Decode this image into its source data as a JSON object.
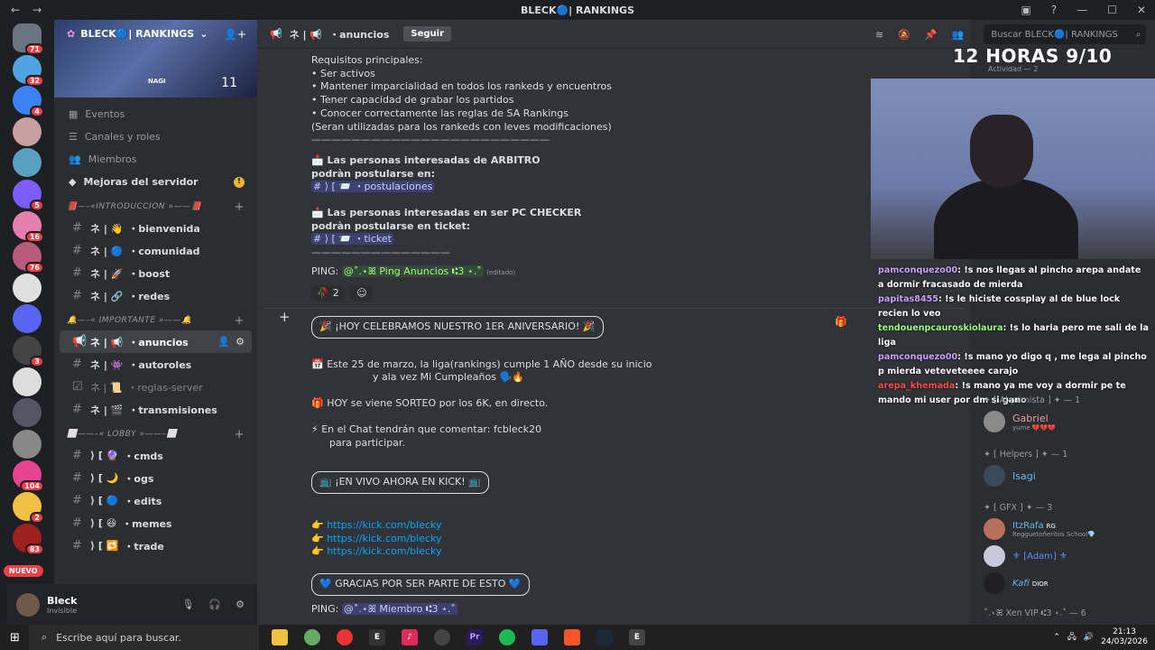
{
  "window": {
    "title": "BLECK🔵| RANKINGS"
  },
  "servers": [
    {
      "badge": "71"
    },
    {
      "badge": "32"
    },
    {
      "badge": "4"
    },
    {
      "badge": ""
    },
    {
      "badge": ""
    },
    {
      "badge": "5"
    },
    {
      "badge": "16"
    },
    {
      "badge": "76"
    },
    {
      "badge": ""
    },
    {
      "badge": ""
    },
    {
      "badge": "3"
    },
    {
      "badge": ""
    },
    {
      "badge": ""
    },
    {
      "badge": ""
    },
    {
      "badge": "104"
    },
    {
      "badge": "2"
    },
    {
      "badge": "83"
    }
  ],
  "nuevo": "NUEVO",
  "guild": {
    "name": "BLECK🔵| RANKINGS",
    "banner_char": "NAGI",
    "banner_ii": "11"
  },
  "menu": [
    {
      "label": "Eventos"
    },
    {
      "label": "Canales y roles"
    },
    {
      "label": "Miembros"
    },
    {
      "label": "Mejoras del servidor",
      "warn": "!"
    }
  ],
  "categories": {
    "introduccion": "📕—–«INTRODUCCION »——📕",
    "importante": "🔔—–« IMPORTANTE »——🔔",
    "lobby": "⬜——–« LOBBY »——–⬜"
  },
  "channels_intro": [
    {
      "prefix": "ネ | 👋",
      "label": "・bienvenida"
    },
    {
      "prefix": "ネ | 🔵",
      "label": "・comunidad"
    },
    {
      "prefix": "ネ | 🚀",
      "label": "・boost"
    },
    {
      "prefix": "ネ | 🔗",
      "label": "・redes"
    }
  ],
  "channels_imp": [
    {
      "prefix": "ネ | 📢",
      "label": "・anuncios"
    },
    {
      "prefix": "ネ | 👾",
      "label": "・autoroles"
    },
    {
      "prefix": "ネ | 📜",
      "label": "・reglas-server"
    },
    {
      "prefix": "ネ | 🎬",
      "label": "・transmisiones"
    }
  ],
  "channels_lobby": [
    {
      "prefix": "⟩ [ 🔮",
      "label": "・cmds"
    },
    {
      "prefix": "⟩ [ 🌙",
      "label": "・ogs"
    },
    {
      "prefix": "⟩ [ 🔵",
      "label": "・edits"
    },
    {
      "prefix": "⟩ [ 😆",
      "label": "・memes"
    },
    {
      "prefix": "⟩ [ 🔁",
      "label": "・trade"
    }
  ],
  "user": {
    "name": "Bleck",
    "status": "Invisible"
  },
  "header": {
    "channel_prefix": "ネ | 📢",
    "channel": "・anuncios",
    "follow": "Seguir",
    "search": "Buscar BLECK🔵| RANKINGS"
  },
  "msg1": {
    "lines": [
      "Requisitos principales:",
      "• Ser activos",
      "• Mantener imparcialidad en todos los rankeds y encuentros",
      "• Tener capacidad de grabar los partidos",
      "• Conocer correctamente las reglas de SA Rankings",
      "(Seran utilizadas para los rankeds con leves modificaciones)",
      "————————————————————————"
    ],
    "arbitro_1": "📩 Las personas interesadas de ARBITRO",
    "arbitro_2": "podràn postularse en:",
    "arbitro_ch": "# ⟩ [ 📨 ・postulaciones",
    "pc_1": "📩 Las personas interesadas en ser PC CHECKER",
    "pc_2": "podràn postularse en ticket:",
    "pc_ch": "# ⟩ [ 📨 ・ticket",
    "rule": "——————————————",
    "ping": "PING:",
    "ping_role": "@˚.⋆ꕤ Ping Anuncios ⑆3 ⋆.˚",
    "edited": "(editado)",
    "reaction_count": "2"
  },
  "msg2": {
    "title": "🎉 ¡HOY CELEBRAMOS NUESTRO 1ER ANIVERSARIO! 🎉",
    "l1": "📅 Este 25 de marzo, la liga(rankings) cumple 1 AÑO desde su inicio",
    "l2": "y ala vez Mi Cumpleaños 🗣️🔥",
    "l3": "🎁 HOY se viene SORTEO por los 6K, en directo.",
    "l4": "⚡ En el Chat tendrán que comentar: fcbleck20",
    "l5": "para participar.",
    "kick": "📺 ¡EN VIVO AHORA EN KICK! 📺",
    "links": [
      "https://kick.com/blecky",
      "https://kick.com/blecky",
      "https://kick.com/blecky"
    ],
    "thanks": "💙 GRACIAS POR SER PARTE DE ESTO 💙",
    "ping": "PING:",
    "ping_role": "@˚.⋆ꕤ Miembro ⑆3 ⋆.˚"
  },
  "overlay": {
    "title": "12 HORAS 9/10",
    "activity": "Actividad — 2"
  },
  "chat": [
    {
      "user": "pamconquezo00",
      "color": "#c9a2ff",
      "text": ": !s nos llegas al pincho arepa andate a dormir fracasado de mierda"
    },
    {
      "user": "papitas8455",
      "color": "#c9a2ff",
      "text": ": !s le hiciste cossplay al de blue lock recien lo veo"
    },
    {
      "user": "tendouenpcauroskiolaura",
      "color": "#9cff7a",
      "text": ": !s lo haria pero me sali de la liga"
    },
    {
      "user": "pamconquezo00",
      "color": "#c9a2ff",
      "text": ": !s mano yo digo q , me lega al pincho p mierda veteveteeee carajo"
    },
    {
      "user": "arepa_khemada",
      "color": "#ff4d4d",
      "text": ": !s mano ya me voy a dormir pe te mando mi user por dm si gano"
    }
  ],
  "members": {
    "alquimista": "✦ [ Alquimista ] ✦ — 1",
    "gabriel": "Gabriel",
    "gabriel_status": "yume 💔💔💔",
    "helpers": "✦ [ Helpers ] ✦ — 1",
    "isagi": "Isagi",
    "gfx": "✦ [ GFX ] ✦ — 3",
    "itzrafa": "ItzRafa",
    "itzrafa_tag": "RG",
    "itzrafa_status": "Regguetoñeritos School💎",
    "adam": "⚜ [Adam] ⚜",
    "kafi": "Kafi",
    "kafi_tag": "DIOR",
    "xenvip": "˚.⋆ꕤ Xen VIP ⑆3 ⋆.˚ — 6"
  },
  "taskbar": {
    "search": "Escribe aquí para buscar.",
    "time": "21:13",
    "date": "24/03/2026"
  }
}
